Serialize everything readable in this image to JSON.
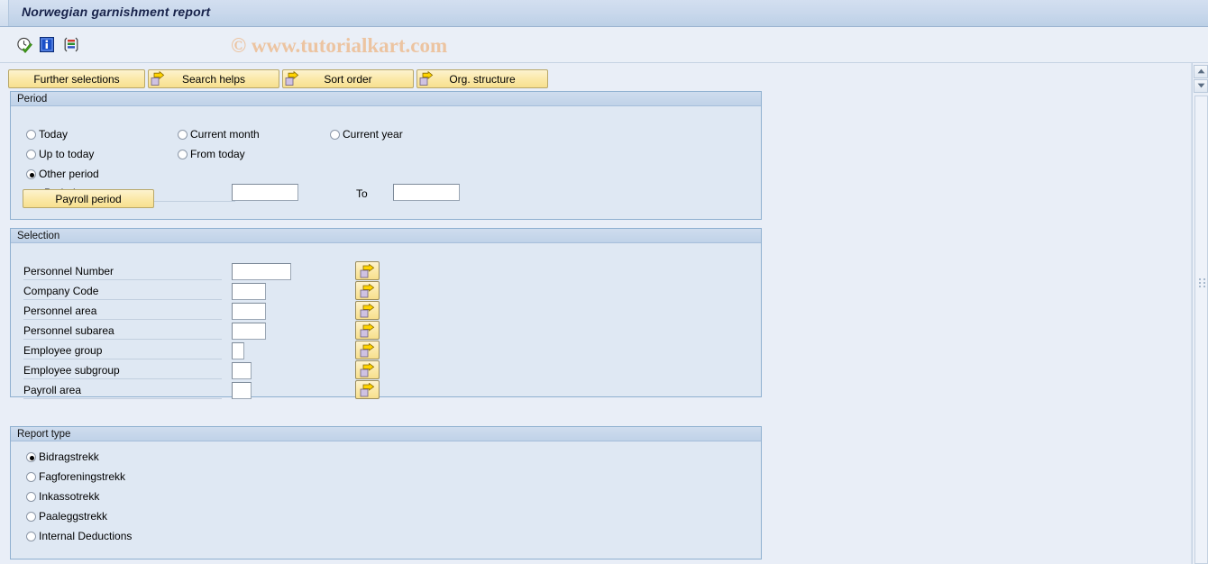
{
  "window": {
    "title": "Norwegian garnishment report",
    "watermark": "© www.tutorialkart.com"
  },
  "toolbar": {
    "icons": [
      {
        "name": "execute-clock-check-icon",
        "tooltip": "Execute"
      },
      {
        "name": "information-icon",
        "tooltip": "Information"
      },
      {
        "name": "multiple-selection-icon",
        "tooltip": "Multiple selection"
      }
    ]
  },
  "action_buttons": [
    {
      "label": "Further selections",
      "has_arrow": false
    },
    {
      "label": "Search helps",
      "has_arrow": true
    },
    {
      "label": "Sort order",
      "has_arrow": true
    },
    {
      "label": "Org. structure",
      "has_arrow": true
    }
  ],
  "period": {
    "title": "Period",
    "options": [
      {
        "label": "Today",
        "selected": false
      },
      {
        "label": "Current month",
        "selected": false
      },
      {
        "label": "Current year",
        "selected": false
      },
      {
        "label": "Up to today",
        "selected": false
      },
      {
        "label": "From today",
        "selected": false
      },
      {
        "label": "Other period",
        "selected": true
      }
    ],
    "period_label": "Period",
    "period_value": "",
    "to_label": "To",
    "to_value": "",
    "payroll_period_button": "Payroll period"
  },
  "selection": {
    "title": "Selection",
    "rows": [
      {
        "label": "Personnel Number",
        "value": "",
        "field_width": 74
      },
      {
        "label": "Company Code",
        "value": "",
        "field_width": 38
      },
      {
        "label": "Personnel area",
        "value": "",
        "field_width": 38
      },
      {
        "label": "Personnel subarea",
        "value": "",
        "field_width": 38
      },
      {
        "label": "Employee group",
        "value": "",
        "field_width": 14
      },
      {
        "label": "Employee subgroup",
        "value": "",
        "field_width": 22
      },
      {
        "label": "Payroll area",
        "value": "",
        "field_width": 22
      }
    ],
    "multi_select_tooltip": "Multiple selection"
  },
  "report_type": {
    "title": "Report type",
    "options": [
      {
        "label": "Bidragstrekk",
        "selected": true
      },
      {
        "label": "Fagforeningstrekk",
        "selected": false
      },
      {
        "label": "Inkassotrekk",
        "selected": false
      },
      {
        "label": "Paaleggstrekk",
        "selected": false
      },
      {
        "label": "Internal Deductions",
        "selected": false
      }
    ]
  },
  "scrollbar": {
    "up_arrow": "▲",
    "down_arrow": "▼"
  },
  "colors": {
    "window_bg": "#e9eef7",
    "panel_bg": "#dfe8f3",
    "panel_border": "#8fb0d0",
    "button_yellow": "#fbe9a8",
    "title_text": "#17224a",
    "watermark": "#edbd93"
  }
}
